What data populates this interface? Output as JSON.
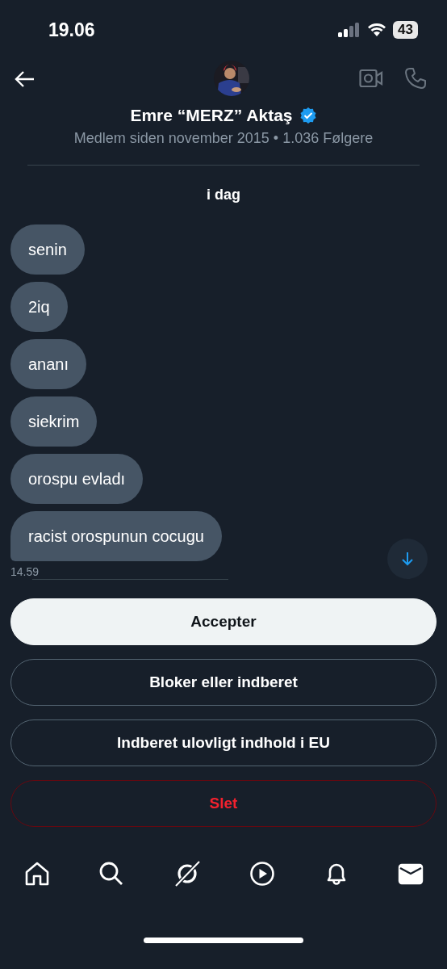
{
  "status_bar": {
    "time": "19.06",
    "battery": "43"
  },
  "header": {
    "name": "Emre “MERZ” Aktaş",
    "verified": true,
    "subtitle": "Medlem siden november 2015 • 1.036 Følgere"
  },
  "conversation": {
    "day": "i dag",
    "messages": [
      {
        "text": "senin"
      },
      {
        "text": "2iq"
      },
      {
        "text": "ananı"
      },
      {
        "text": "siekrim"
      },
      {
        "text": "orospu evladı"
      },
      {
        "text": "racist orospunun cocugu"
      }
    ],
    "time": "14.59"
  },
  "actions": [
    {
      "label": "Accepter",
      "kind": "primary"
    },
    {
      "label": "Bloker eller indberet",
      "kind": "outline"
    },
    {
      "label": "Indberet ulovligt indhold i EU",
      "kind": "outline"
    },
    {
      "label": "Slet",
      "kind": "danger"
    }
  ],
  "tab_bar": [
    {
      "kind": "home",
      "selected": false
    },
    {
      "kind": "search",
      "selected": false
    },
    {
      "kind": "grok",
      "selected": false
    },
    {
      "kind": "video",
      "selected": false
    },
    {
      "kind": "notifications",
      "selected": false
    },
    {
      "kind": "messages",
      "selected": true
    }
  ]
}
